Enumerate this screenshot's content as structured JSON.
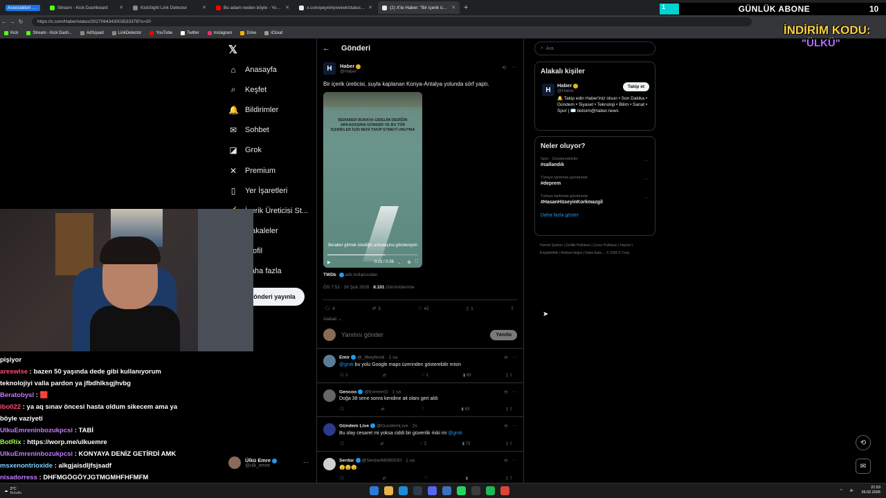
{
  "browser": {
    "tabs": [
      {
        "label": "Association Football",
        "color": "#1a73e8"
      },
      {
        "label": "Stream - Kick Dashboard",
        "color": "#53fc18"
      },
      {
        "label": "KickSight Link Detector",
        "color": "#888888"
      },
      {
        "label": "Bu adam neden böyle - YouTube",
        "color": "#ff0000"
      },
      {
        "label": "x.com/peyniriyiverek/status/2026...",
        "color": "#e7e9ea"
      },
      {
        "label": "(2) X'te Haber: \"Bir içerik üretici...",
        "color": "#e7e9ea"
      }
    ],
    "url": "https://x.com/Haber/status/2027064343003533378?s=20",
    "bookmarks": [
      "Kick",
      "Stream - Kick Dash...",
      "AdSquad",
      "LinkDetector",
      "YouTube",
      "Twitter",
      "Instagram",
      "Drive",
      "iCloud"
    ]
  },
  "overlay": {
    "abone_num_left": "1",
    "abone_label": "GÜNLÜK ABONE",
    "abone_num_right": "10",
    "indirim": "İNDİRİM KODU:",
    "kod": "\"ÜLKÜ\""
  },
  "nav": {
    "items": [
      {
        "icon": "⌂",
        "label": "Anasayfa"
      },
      {
        "icon": "⌕",
        "label": "Keşfet"
      },
      {
        "icon": "🔔",
        "label": "Bildirimler"
      },
      {
        "icon": "✉",
        "label": "Sohbet"
      },
      {
        "icon": "◪",
        "label": "Grok"
      },
      {
        "icon": "✕",
        "label": "Premium"
      },
      {
        "icon": "▯",
        "label": "Yer İşaretleri"
      },
      {
        "icon": "⚡",
        "label": "İçerik Üreticisi St..."
      },
      {
        "icon": "☰",
        "label": "Makaleler"
      },
      {
        "icon": "☺",
        "label": "Profil"
      },
      {
        "icon": "⋯",
        "label": "Daha fazla"
      }
    ],
    "post_button": "Gönderi yayınla",
    "account_name": "Ülkü Emre",
    "account_handle": "@ulk_emre"
  },
  "center": {
    "title": "Gönderi",
    "post": {
      "name": "Haber",
      "handle": "@Haber",
      "text": "Bir içerik üreticisi, suyla kaplanan Konya-Antalya yolunda sörf yaptı.",
      "video_caption": "BERABER BURAYA GİDELİM DEDİĞİN ARKADAŞINA GÖNDER VE BU TÜR İÇERİKLER İÇİN BENİ TAKİP ETMEYİ UNUTMA",
      "video_subtitle": "Beraber gitmek istediğin arkadaşına göndereyim",
      "video_time": "0:23 / 0:36",
      "video_progress": 0.64,
      "source_name": "TWDb",
      "source_suffix": "adlı kullanıcıdan",
      "time": "ÖS 7:52 · 26 Şub 2026 ·",
      "views": "8.101",
      "views_label": "Görüntülenme",
      "replies": "4",
      "reposts": "3",
      "likes": "42",
      "bookmarks": "1",
      "related": "Alakalı"
    },
    "reply_placeholder": "Yanıtını gönder",
    "reply_button": "Yanıtla",
    "replies": [
      {
        "name": "Emir",
        "handle": "@_llbeyfendi · 1 sa",
        "mention": "@grok",
        "text": " bu yolu Google maps üzerinden gösterebilir misin",
        "r": "1",
        "l": "1",
        "v": "83",
        "color": "#5a7d9a"
      },
      {
        "name": "Gencoo",
        "handle": "@EsmerrO · 1 sa",
        "mention": "",
        "text": "Doğa 38 sene sonra kendine ait olanı geri aldı",
        "r": "",
        "l": "",
        "v": "63",
        "color": "#666666"
      },
      {
        "name": "Gündem Live",
        "handle": "@GundemLive · 2s",
        "mention": "",
        "text": "Bu olay cesaret mi yoksa ciddi bir güvenlik riski mi ",
        "text_mention": "@grok",
        "r": "",
        "l": "2",
        "v": "73",
        "color": "#2b3a8a"
      },
      {
        "name": "Serdar",
        "handle": "@Serdar68080030 · 1 sa",
        "mention": "",
        "text": "😯😯😯",
        "r": "",
        "l": "",
        "v": "",
        "color": "#d0d0d0"
      }
    ]
  },
  "right": {
    "search_placeholder": "Ara",
    "related_title": "Alakalı kişiler",
    "person_name": "Haber",
    "person_handle": "@Haber",
    "person_bio": "🔔 Takip edin Haber'iniz olsun • Son Dakika • Gündem • Siyaset • Teknoloji • Bilim • Sanat • Spor | ✉️ iletisim@haber.news",
    "follow": "Takip et",
    "trends_title": "Neler oluyor?",
    "trends": [
      {
        "cat": "Spor · Gündemdekiler",
        "name": "#sallandık"
      },
      {
        "cat": "Türkiye tarihinde gündemde",
        "name": "#deprem"
      },
      {
        "cat": "Türkiye tarihinde gündemde",
        "name": "#HasanHüseyinKorkmazgil"
      }
    ],
    "show_more": "Daha fazla göster",
    "footer": "Hizmet Şartları | Gizlilik Politikası | Çerez Politikası | Imprint | Erişilebilirlik | Reklam bilgisi | Daha fazla ... © 2026 X Corp."
  },
  "chat": [
    {
      "user": "",
      "text": "pişiyor",
      "color": "#ffffff"
    },
    {
      "user": "areswise",
      "text": ": bazen 50 yaşında dede gibi kullanıyorum",
      "color": "#ff4d6d"
    },
    {
      "user": "",
      "text": "teknolojiyi valla pardon ya jfbdhlksgjhvbg",
      "color": "#ffffff"
    },
    {
      "user": "Beratobysl",
      "text": ": 🟥",
      "color": "#c27bff"
    },
    {
      "user": "ibo022",
      "text": ": ya aq sınav öncesi hasta oldum sikecem ama ya",
      "color": "#ff4d6d"
    },
    {
      "user": "",
      "text": "böyle vaziyeti",
      "color": "#ffffff"
    },
    {
      "user": "UlkuEmreninbozukpcsi",
      "text": ": TABİ",
      "color": "#c27bff"
    },
    {
      "user": "BotRix",
      "text": ": https://worp.me/ulkuemre",
      "color": "#9aff4d"
    },
    {
      "user": "UlkuEmreninbozukpcsi",
      "text": ": KONYAYA DENİZ GETİRDİ AMK",
      "color": "#c27bff"
    },
    {
      "user": "msxenontrioxide",
      "text": ": alkgjaisdljfsjsadf",
      "color": "#7fd0ff"
    },
    {
      "user": "nisadorress",
      "text": ": DHFMGÖGÖYJGTMGMHFHFMFM",
      "color": "#c27bff"
    }
  ],
  "taskbar": {
    "temp": "3°C",
    "weather": "Bulutlu",
    "time": "21:53",
    "date": "26.02.2026"
  }
}
